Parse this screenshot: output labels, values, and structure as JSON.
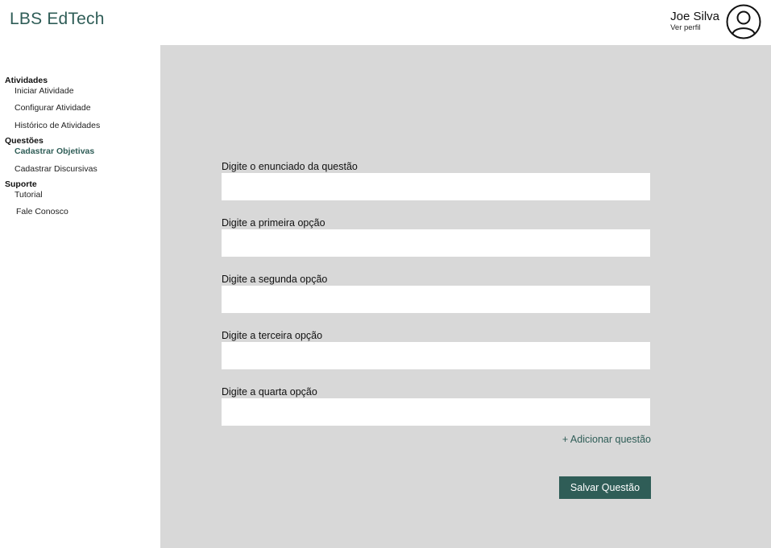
{
  "header": {
    "brand": "LBS EdTech",
    "user_name": "Joe Silva",
    "user_link": "Ver perfil"
  },
  "sidebar": {
    "groups": [
      {
        "title": "Atividades",
        "items": [
          {
            "label": "Iniciar Atividade"
          },
          {
            "label": "Configurar Atividade"
          },
          {
            "label": "Histórico de Atividades"
          }
        ]
      },
      {
        "title": "Questões",
        "items": [
          {
            "label": "Cadastrar Objetivas",
            "active": true
          },
          {
            "label": "Cadastrar Discursivas"
          }
        ]
      },
      {
        "title": "Suporte",
        "items": [
          {
            "label": "Tutorial"
          },
          {
            "label": "Fale Conosco"
          }
        ]
      }
    ]
  },
  "form": {
    "fields": [
      {
        "label": "Digite o enunciado da questão",
        "value": ""
      },
      {
        "label": "Digite a primeira opção",
        "value": ""
      },
      {
        "label": "Digite a segunda opção",
        "value": ""
      },
      {
        "label": "Digite a terceira opção",
        "value": ""
      },
      {
        "label": "Digite a quarta opção",
        "value": ""
      }
    ],
    "add_link": "+ Adicionar questão",
    "save_label": "Salvar Questão"
  },
  "colors": {
    "accent": "#2f5d57",
    "panel": "#d8d8d8"
  },
  "icons": {
    "avatar": "user-circle-icon"
  }
}
